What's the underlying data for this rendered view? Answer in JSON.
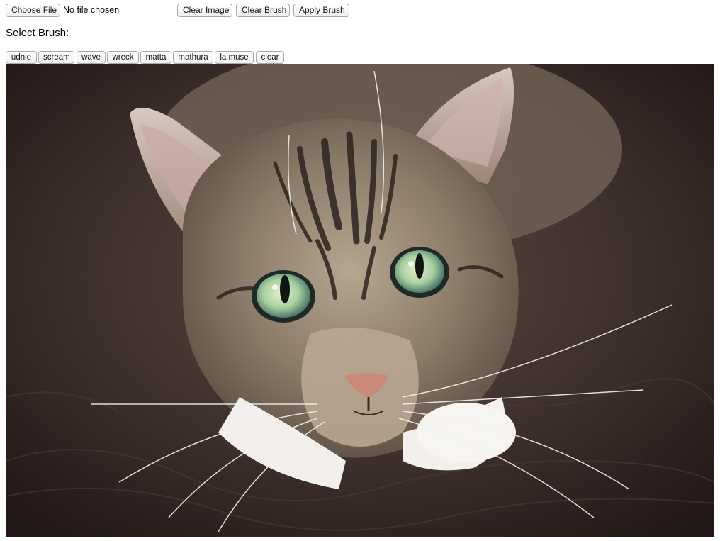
{
  "file_input": {
    "button_label": "Choose File",
    "status": "No file chosen"
  },
  "toolbar": {
    "clear_image_label": "Clear Image",
    "clear_brush_label": "Clear Brush",
    "apply_brush_label": "Apply Brush"
  },
  "brush": {
    "heading": "Select Brush:",
    "options": [
      "udnie",
      "scream",
      "wave",
      "wreck",
      "matta",
      "mathura",
      "la muse",
      "clear"
    ]
  },
  "image": {
    "subject": "tabby cat looking up",
    "colors": {
      "background": "#3a2c29",
      "fur": "#8a7a68",
      "eyes": "#b7d9a9"
    }
  }
}
